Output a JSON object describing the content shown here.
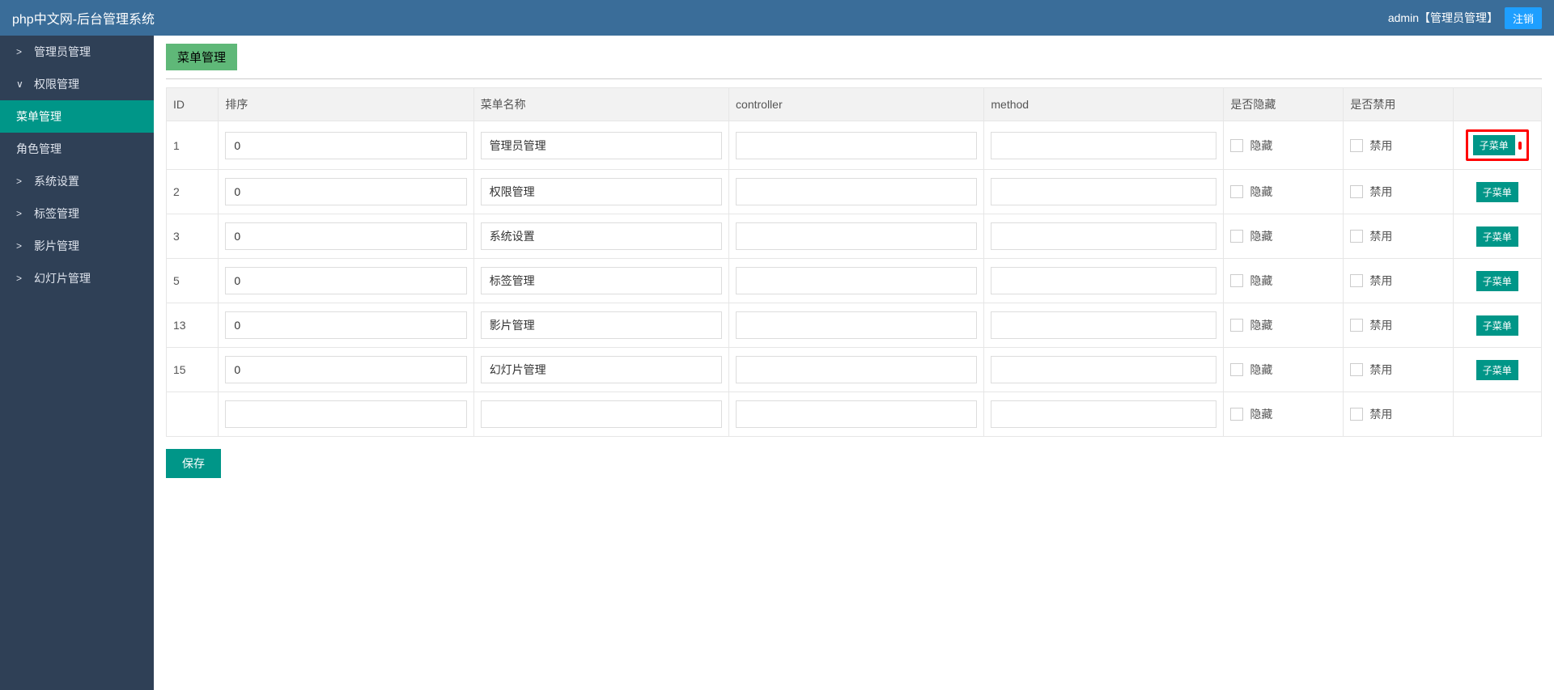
{
  "header": {
    "title": "php中文网-后台管理系统",
    "user_text": "admin【管理员管理】",
    "logout": "注销"
  },
  "sidebar": {
    "items": [
      {
        "label": "管理员管理",
        "expanded": false,
        "children": []
      },
      {
        "label": "权限管理",
        "expanded": true,
        "children": [
          {
            "label": "菜单管理",
            "active": true
          },
          {
            "label": "角色管理",
            "active": false
          }
        ]
      },
      {
        "label": "系统设置",
        "expanded": false,
        "children": []
      },
      {
        "label": "标签管理",
        "expanded": false,
        "children": []
      },
      {
        "label": "影片管理",
        "expanded": false,
        "children": []
      },
      {
        "label": "幻灯片管理",
        "expanded": false,
        "children": []
      }
    ]
  },
  "page": {
    "title": "菜单管理",
    "save_btn": "保存"
  },
  "table": {
    "headers": {
      "id": "ID",
      "sort": "排序",
      "name": "菜单名称",
      "controller": "controller",
      "method": "method",
      "hidden": "是否隐藏",
      "disabled": "是否禁用"
    },
    "labels": {
      "hidden": "隐藏",
      "disabled": "禁用",
      "submenu": "子菜单"
    },
    "rows": [
      {
        "id": "1",
        "sort": "0",
        "name": "管理员管理",
        "controller": "",
        "method": "",
        "highlight": true
      },
      {
        "id": "2",
        "sort": "0",
        "name": "权限管理",
        "controller": "",
        "method": "",
        "highlight": false
      },
      {
        "id": "3",
        "sort": "0",
        "name": "系统设置",
        "controller": "",
        "method": "",
        "highlight": false
      },
      {
        "id": "5",
        "sort": "0",
        "name": "标签管理",
        "controller": "",
        "method": "",
        "highlight": false
      },
      {
        "id": "13",
        "sort": "0",
        "name": "影片管理",
        "controller": "",
        "method": "",
        "highlight": false
      },
      {
        "id": "15",
        "sort": "0",
        "name": "幻灯片管理",
        "controller": "",
        "method": "",
        "highlight": false
      },
      {
        "id": "",
        "sort": "",
        "name": "",
        "controller": "",
        "method": "",
        "empty": true
      }
    ]
  }
}
